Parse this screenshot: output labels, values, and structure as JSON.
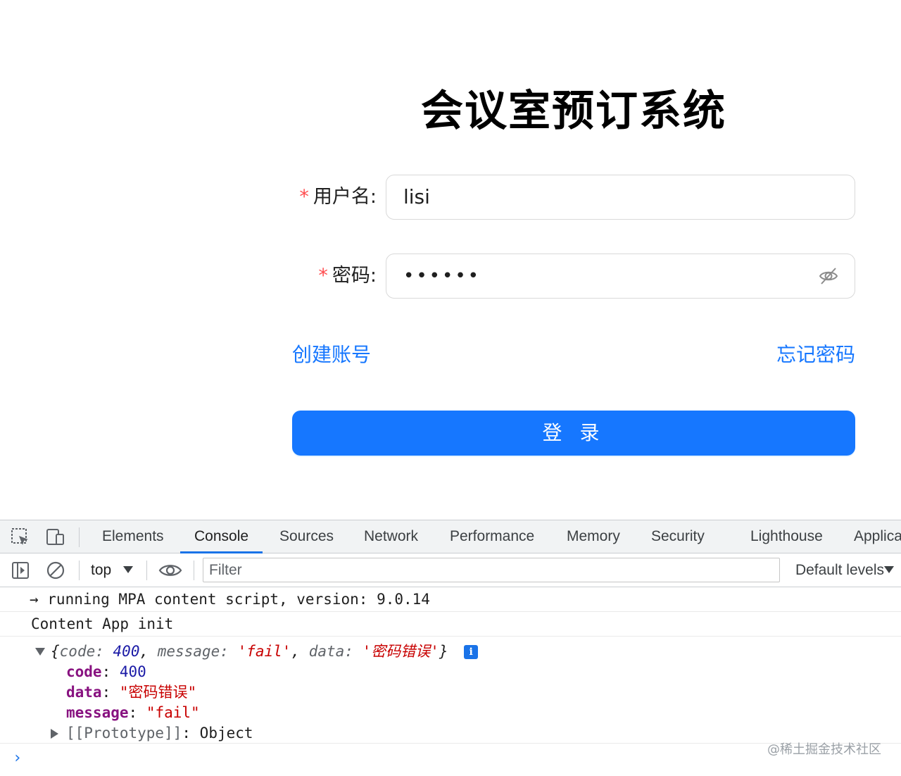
{
  "login": {
    "title": "会议室预订系统",
    "username": {
      "required_mark": "*",
      "label": "用户名:",
      "value": "lisi"
    },
    "password": {
      "required_mark": "*",
      "label": "密码:",
      "masked_value": "••••••",
      "toggle_icon": "eye-invisible-icon"
    },
    "create_account_link": "创建账号",
    "forgot_password_link": "忘记密码",
    "login_button": "登 录",
    "accent_color": "#1677ff"
  },
  "devtools": {
    "tabs": [
      "Elements",
      "Console",
      "Sources",
      "Network",
      "Performance",
      "Memory",
      "Security",
      "Lighthouse",
      "Applica"
    ],
    "active_tab": "Console",
    "context": "top",
    "filter_placeholder": "Filter",
    "levels": "Default levels",
    "console": {
      "line1": "→ running MPA content script, version: 9.0.14",
      "line2": "Content App init",
      "object_preview": {
        "open": "{",
        "k1": "code",
        "v1": "400",
        "k2": "message",
        "v2": "'fail'",
        "k3": "data",
        "v3": "'密码错误'",
        "close": "}"
      },
      "props": [
        {
          "key": "code",
          "value": "400"
        },
        {
          "key": "data",
          "value": "\"密码错误\""
        },
        {
          "key": "message",
          "value": "\"fail\""
        }
      ],
      "prototype": {
        "key": "[[Prototype]]",
        "value": "Object"
      },
      "prompt": "›"
    }
  },
  "watermark": "@稀土掘金技术社区"
}
